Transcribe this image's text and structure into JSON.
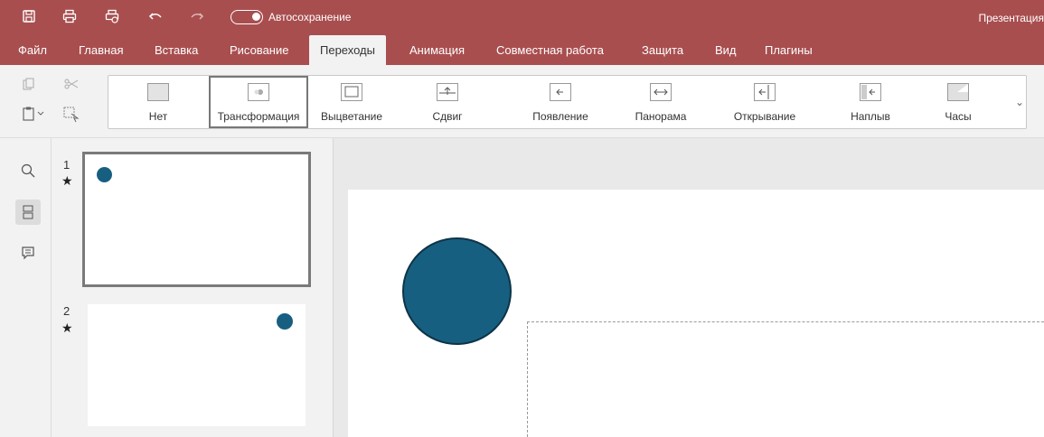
{
  "quick_access": {
    "autosave_label": "Автосохранение",
    "doc_title": "Презентация"
  },
  "tabs": [
    {
      "label": "Файл"
    },
    {
      "label": "Главная"
    },
    {
      "label": "Вставка"
    },
    {
      "label": "Рисование"
    },
    {
      "label": "Переходы",
      "active": true
    },
    {
      "label": "Анимация"
    },
    {
      "label": "Совместная работа"
    },
    {
      "label": "Защита"
    },
    {
      "label": "Вид"
    },
    {
      "label": "Плагины"
    }
  ],
  "transitions": [
    {
      "label": "Нет",
      "icon": "none-transition-icon"
    },
    {
      "label": "Трансформация",
      "icon": "morph-transition-icon",
      "selected": true
    },
    {
      "label": "Выцветание",
      "icon": "fade-transition-icon"
    },
    {
      "label": "Сдвиг",
      "icon": "push-transition-icon"
    },
    {
      "label": "Появление",
      "icon": "wipe-transition-icon"
    },
    {
      "label": "Панорама",
      "icon": "split-transition-icon"
    },
    {
      "label": "Открывание",
      "icon": "uncover-transition-icon"
    },
    {
      "label": "Наплыв",
      "icon": "cover-transition-icon"
    },
    {
      "label": "Часы",
      "icon": "clock-transition-icon"
    }
  ],
  "slides": [
    {
      "number": "1",
      "has_transition": true,
      "selected": true
    },
    {
      "number": "2",
      "has_transition": true,
      "selected": false
    }
  ],
  "colors": {
    "header": "#a94e4f",
    "shape_fill": "#175f81",
    "shape_stroke": "#0d3447"
  }
}
